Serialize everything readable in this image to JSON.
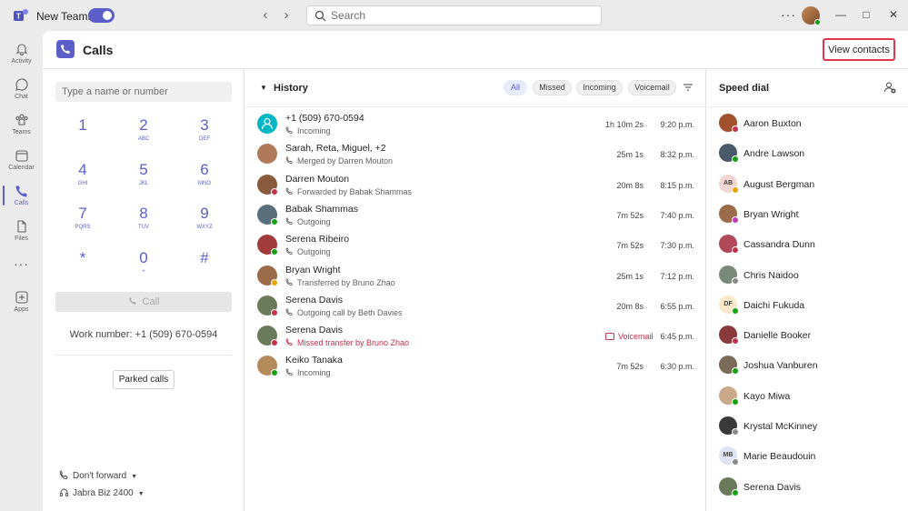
{
  "app": {
    "name": "New Teams",
    "search_placeholder": "Search",
    "brand_color": "#5b5fc7"
  },
  "rail": {
    "items": [
      {
        "label": "Activity",
        "icon": "bell-icon"
      },
      {
        "label": "Chat",
        "icon": "chat-icon"
      },
      {
        "label": "Teams",
        "icon": "teams-icon"
      },
      {
        "label": "Calendar",
        "icon": "calendar-icon"
      },
      {
        "label": "Calls",
        "icon": "phone-icon",
        "active": true
      },
      {
        "label": "Files",
        "icon": "file-icon"
      },
      {
        "label": "Apps",
        "icon": "apps-icon"
      }
    ],
    "more": "···"
  },
  "header": {
    "title": "Calls",
    "view_contacts": "View contacts"
  },
  "dialpad": {
    "input_placeholder": "Type a name or number",
    "keys": [
      {
        "digit": "1",
        "letters": ""
      },
      {
        "digit": "2",
        "letters": "ABC"
      },
      {
        "digit": "3",
        "letters": "DEF"
      },
      {
        "digit": "4",
        "letters": "GHI"
      },
      {
        "digit": "5",
        "letters": "JKL"
      },
      {
        "digit": "6",
        "letters": "MNO"
      },
      {
        "digit": "7",
        "letters": "PQRS"
      },
      {
        "digit": "8",
        "letters": "TUV"
      },
      {
        "digit": "9",
        "letters": "WXYZ"
      },
      {
        "digit": "*",
        "letters": ""
      },
      {
        "digit": "0",
        "letters": "+"
      },
      {
        "digit": "#",
        "letters": ""
      }
    ],
    "call_label": "Call",
    "work_number": "Work number: +1 (509) 670-0594",
    "parked_calls": "Parked calls",
    "forward_label": "Don't forward",
    "device_label": "Jabra Biz 2400"
  },
  "history": {
    "title": "History",
    "filters": [
      "All",
      "Missed",
      "Incoming",
      "Voicemail"
    ],
    "selected_filter": "All",
    "rows": [
      {
        "name": "+1 (509) 670-0594",
        "detail": "Incoming",
        "duration": "1h 10m 2s",
        "time": "9:20 p.m.",
        "status": "none",
        "avatar": "#00b7c3"
      },
      {
        "name": "Sarah, Reta, Miguel, +2",
        "detail": "Merged by Darren Mouton",
        "duration": "25m 1s",
        "time": "8:32 p.m.",
        "status": "none",
        "avatar": "#b07a5a"
      },
      {
        "name": "Darren Mouton",
        "detail": "Forwarded by Babak Shammas",
        "duration": "20m 8s",
        "time": "8:15 p.m.",
        "status": "busy",
        "avatar": "#8a5a3c"
      },
      {
        "name": "Babak Shammas",
        "detail": "Outgoing",
        "duration": "7m 52s",
        "time": "7:40 p.m.",
        "status": "available",
        "avatar": "#5a6e7c"
      },
      {
        "name": "Serena Ribeiro",
        "detail": "Outgoing",
        "duration": "7m 52s",
        "time": "7:30 p.m.",
        "status": "available",
        "avatar": "#a03c3c"
      },
      {
        "name": "Bryan Wright",
        "detail": "Transferred by Bruno Zhao",
        "duration": "25m 1s",
        "time": "7:12 p.m.",
        "status": "away",
        "avatar": "#9c6b4a"
      },
      {
        "name": "Serena Davis",
        "detail": "Outgoing call by Beth Davies",
        "duration": "20m 8s",
        "time": "6:55 p.m.",
        "status": "busy",
        "avatar": "#6a7a5a"
      },
      {
        "name": "Serena Davis",
        "detail": "Missed transfer by Bruno Zhao",
        "voicemail": "Voicemail",
        "time": "6:45 p.m.",
        "status": "busy",
        "avatar": "#6a7a5a",
        "missed": true
      },
      {
        "name": "Keiko Tanaka",
        "detail": "Incoming",
        "duration": "7m 52s",
        "time": "6:30 p.m.",
        "status": "available",
        "avatar": "#b58a5a"
      }
    ]
  },
  "speed_dial": {
    "title": "Speed dial",
    "contacts": [
      {
        "name": "Aaron Buxton",
        "status": "busy",
        "avatar": "#a0522d",
        "initials": ""
      },
      {
        "name": "Andre Lawson",
        "status": "available",
        "avatar": "#4a5a6a",
        "initials": ""
      },
      {
        "name": "August Bergman",
        "status": "away",
        "avatar": "#f4d6d2",
        "initials": "AB"
      },
      {
        "name": "Bryan Wright",
        "status": "dnd",
        "avatar": "#9c6b4a",
        "initials": ""
      },
      {
        "name": "Cassandra Dunn",
        "status": "busy",
        "avatar": "#b04a5a",
        "initials": ""
      },
      {
        "name": "Chris Naidoo",
        "status": "offline",
        "avatar": "#7a8a7a",
        "initials": ""
      },
      {
        "name": "Daichi Fukuda",
        "status": "available",
        "avatar": "#fbe7c9",
        "initials": "DF"
      },
      {
        "name": "Danielle Booker",
        "status": "busy",
        "avatar": "#8a3a3a",
        "initials": ""
      },
      {
        "name": "Joshua Vanburen",
        "status": "available",
        "avatar": "#7a6a5a",
        "initials": ""
      },
      {
        "name": "Kayo Miwa",
        "status": "available",
        "avatar": "#c9a98a",
        "initials": ""
      },
      {
        "name": "Krystal McKinney",
        "status": "offline",
        "avatar": "#3a3a3a",
        "initials": ""
      },
      {
        "name": "Marie Beaudouin",
        "status": "offline",
        "avatar": "#dfe3f5",
        "initials": "MB"
      },
      {
        "name": "Serena Davis",
        "status": "available",
        "avatar": "#6a7a5a",
        "initials": ""
      }
    ]
  }
}
